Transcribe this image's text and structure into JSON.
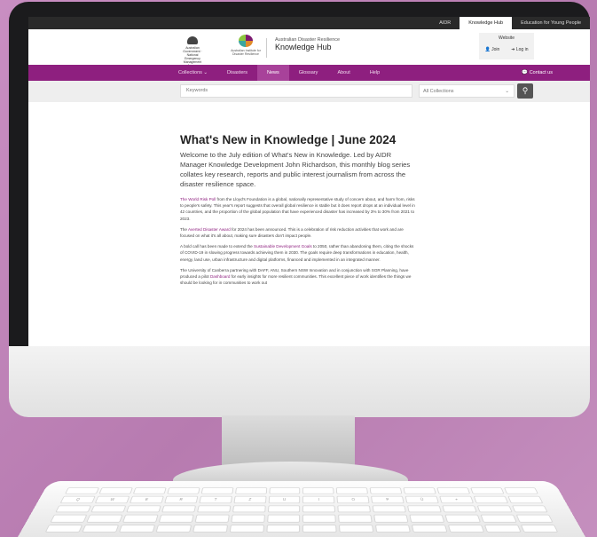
{
  "topbar": {
    "links": [
      "AIDR",
      "Knowledge Hub",
      "Education for Young People"
    ],
    "active": "Knowledge Hub"
  },
  "header": {
    "gov_logo_text": "Australian Government · National Emergency Management Agency",
    "aidr_logo_text": "Australian Institute for Disaster Resilience",
    "site_subtitle": "Australian Disaster Resilience",
    "site_title": "Knowledge Hub",
    "account": {
      "website_label": "Website",
      "join_label": "Join",
      "login_label": "Log in"
    }
  },
  "nav": {
    "items": [
      "Collections ⌄",
      "Disasters",
      "News",
      "Glossary",
      "About",
      "Help"
    ],
    "active": "News",
    "contact_label": "Contact us"
  },
  "search": {
    "placeholder": "Keywords",
    "select_value": "All Collections",
    "button_icon": "search-icon"
  },
  "article": {
    "title": "What's New in Knowledge | June 2024",
    "lead": "Welcome to the July edition of What's New in Knowledge. Led by AIDR Manager Knowledge Development John Richardson, this monthly blog series collates key research, reports and public interest journalism from across the disaster resilience space.",
    "p1_link": "The World Risk Poll",
    "p1_text": " from the Lloyd's Foundation is a global, nationally representative study of concern about, and harm from, risks to people's safety. This year's report suggests that overall global resilience is stable but it does report drops at an individual level in 42 countries, and the proportion of the global population that have experienced disaster has increased by 3% to 30% from 2021 to 2023.",
    "p2_prefix": "The ",
    "p2_link": "Averted Disaster Award",
    "p2_text": " for 2024 has been announced. This is a celebration of risk reduction activities that work and are focused on what it's all about, making sure disasters don't impact people.",
    "p3_prefix": "A bold call has been made to extend the ",
    "p3_link": "Sustainable Development Goals",
    "p3_text": " to 2050, rather than abandoning them, citing the shocks of COVID-19 in slowing progress towards achieving them in 2030. The goals require deep transformations in education, health, energy, land use, urban infrastructure and digital platforms, financed and implemented in an integrated manner.",
    "p4_prefix": "The University of Canberra partnering with DAFF, ANU, Southern NSW Innovation and in conjunction with SGR Planning, have produced a pilot ",
    "p4_link": "Dashboard",
    "p4_text": " for early insights for more resilient communities. This excellent piece of work identifies the things we should be looking for in communities to work out"
  },
  "keyboard": {
    "keys": [
      "Q",
      "W",
      "E",
      "R",
      "T",
      "Z",
      "U",
      "I",
      "O",
      "P",
      "Ü",
      "+",
      "",
      ""
    ]
  },
  "colors": {
    "nav_purple": "#8e1f7f",
    "link_purple": "#8e1f7f",
    "background": "#c98ec2"
  }
}
